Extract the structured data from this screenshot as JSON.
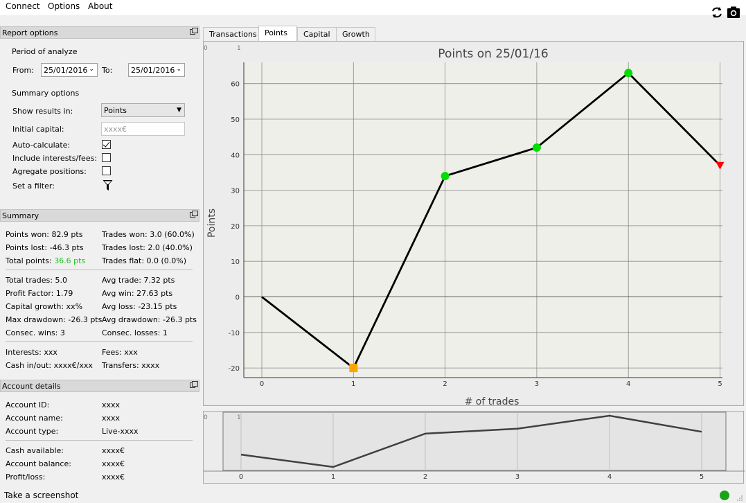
{
  "menu": {
    "connect": "Connect",
    "options": "Options",
    "about": "About"
  },
  "toolbar": {
    "refresh_icon": "refresh-icon",
    "screenshot_icon": "camera-icon"
  },
  "report_options": {
    "title": "Report options",
    "period_label": "Period of analyze",
    "from_label": "From:",
    "from_value": "25/01/2016",
    "to_label": "To:",
    "to_value": "25/01/2016",
    "summary_label": "Summary options",
    "show_results_label": "Show results in:",
    "show_results_value": "Points",
    "initial_capital_label": "Initial capital:",
    "initial_capital_placeholder": "xxxx€",
    "auto_calc_label": "Auto-calculate:",
    "auto_calc_checked": true,
    "include_fees_label": "Include interests/fees:",
    "include_fees_checked": false,
    "aggregate_label": "Agregate positions:",
    "aggregate_checked": false,
    "filter_label": "Set a filter:"
  },
  "summary": {
    "title": "Summary",
    "points_won": "Points won: 82.9 pts",
    "points_lost": "Points lost: -46.3 pts",
    "total_points_label": "Total points: ",
    "total_points_value": "36.6 pts",
    "trades_won": "Trades won: 3.0 (60.0%)",
    "trades_lost": "Trades lost: 2.0 (40.0%)",
    "trades_flat": "Trades flat: 0.0 (0.0%)",
    "total_trades": "Total trades: 5.0",
    "profit_factor": "Profit Factor: 1.79",
    "capital_growth": "Capital growth: xx%",
    "max_drawdown": "Max drawdown: -26.3 pts",
    "consec_wins": "Consec. wins: 3",
    "avg_trade": "Avg trade: 7.32 pts",
    "avg_win": "Avg win: 27.63 pts",
    "avg_loss": "Avg loss: -23.15 pts",
    "avg_drawdown": "Avg drawdown: -26.3 pts",
    "consec_losses": "Consec. losses: 1",
    "interests": "Interests: xxx",
    "cash_inout": "Cash in/out: xxxx€/xxx",
    "fees": "Fees: xxx",
    "transfers": "Transfers: xxxx",
    "positive_color": "#1fbf1f"
  },
  "account": {
    "title": "Account details",
    "id_label": "Account ID:",
    "id_value": "xxxx",
    "name_label": "Account name:",
    "name_value": "xxxx",
    "type_label": "Account type:",
    "type_value": "Live-xxxx",
    "cash_label": "Cash available:",
    "cash_value": "xxxx€",
    "balance_label": "Account balance:",
    "balance_value": "xxxx€",
    "pl_label": "Profit/loss:",
    "pl_value": "xxxx€"
  },
  "tabs": [
    {
      "label": "Transactions"
    },
    {
      "label": "Points"
    },
    {
      "label": "Capital"
    },
    {
      "label": "Growth"
    }
  ],
  "chart_data": {
    "type": "line",
    "title": "Points on 25/01/16",
    "xlabel": "# of trades",
    "ylabel": "Points",
    "x": [
      0,
      1,
      2,
      3,
      4,
      5
    ],
    "values": [
      0,
      -20,
      34,
      42,
      63,
      37
    ],
    "markers": [
      "none",
      "square",
      "circle",
      "circle",
      "circle",
      "triangle-down"
    ],
    "marker_colors": [
      "#000000",
      "#ffa500",
      "#00e000",
      "#00e000",
      "#00e000",
      "#ff0000"
    ],
    "xticks": [
      "0",
      "1",
      "2",
      "3",
      "4",
      "5"
    ],
    "yticks": [
      "-20",
      "-10",
      "0",
      "10",
      "20",
      "30",
      "40",
      "50",
      "60"
    ],
    "xlim": [
      0,
      5
    ],
    "ylim": [
      -22,
      66
    ],
    "grid": true,
    "corner_labels": [
      "0",
      "1"
    ]
  },
  "overview": {
    "xticks": [
      "0",
      "1",
      "2",
      "3",
      "4",
      "5"
    ],
    "corner_labels": [
      "0",
      "1"
    ]
  },
  "status": {
    "text": "Take a screenshot",
    "indicator_color": "#1aa31a"
  }
}
